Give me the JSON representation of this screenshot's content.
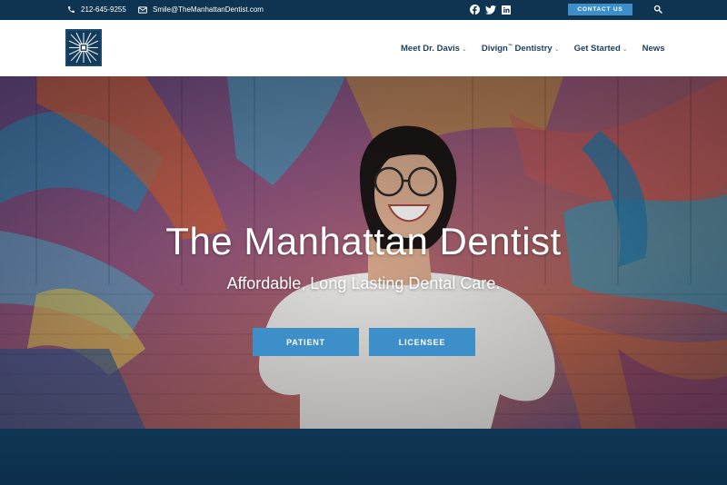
{
  "topbar": {
    "phone": "212-645-9255",
    "email": "Smile@TheManhattanDentist.com",
    "contact_button": "CONTACT US",
    "social_icons": [
      "facebook-icon",
      "twitter-icon",
      "linkedin-icon"
    ]
  },
  "nav": {
    "items": [
      {
        "label": "Meet Dr. Davis",
        "dropdown": true
      },
      {
        "label": "Divign",
        "tm": "™",
        "label_suffix": " Dentistry",
        "dropdown": true
      },
      {
        "label": "Get Started",
        "dropdown": true
      },
      {
        "label": "News",
        "dropdown": false
      }
    ]
  },
  "hero": {
    "title": "The Manhattan Dentist",
    "subtitle": "Affordable, Long Lasting Dental Care.",
    "buttons": {
      "patient": "PATIENT",
      "licensee": "LICENSEE"
    }
  },
  "colors": {
    "navy": "#0e3452",
    "accent": "#3d8fc9",
    "nav_text": "#1b3e5e"
  }
}
